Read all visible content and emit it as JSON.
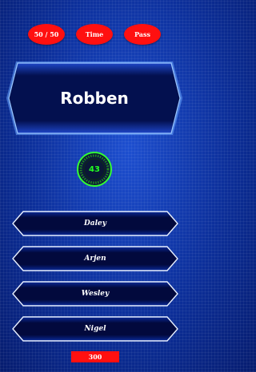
{
  "lifelines": [
    {
      "label": "50 / 50"
    },
    {
      "label": "Time"
    },
    {
      "label": "Pass"
    }
  ],
  "question": {
    "text": "Robben"
  },
  "timer": {
    "value": "43"
  },
  "answers": [
    {
      "label": "Daley"
    },
    {
      "label": "Arjen"
    },
    {
      "label": "Wesley"
    },
    {
      "label": "Nigel"
    }
  ],
  "score": {
    "value": "300"
  },
  "colors": {
    "background": "#0a2a8c",
    "lifeline": "#ff1010",
    "panel": "#020a4a",
    "panel_border": "#7fb4ff",
    "timer": "#22ff22",
    "score_bar": "#ff1010"
  }
}
